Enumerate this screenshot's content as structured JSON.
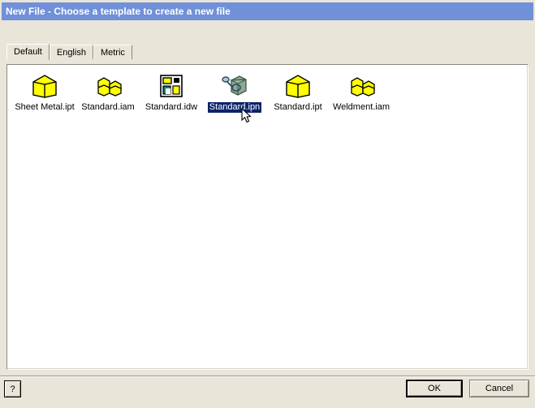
{
  "window": {
    "title": "New File - Choose a template to create a new file",
    "titlebar_color": "#7090d8",
    "background_color": "#e9e5d8"
  },
  "tabs": [
    {
      "label": "Default",
      "selected": true
    },
    {
      "label": "English",
      "selected": false
    },
    {
      "label": "Metric",
      "selected": false
    }
  ],
  "templates": [
    {
      "label": "Sheet Metal.ipt",
      "icon": "part-cube-icon",
      "selected": false
    },
    {
      "label": "Standard.iam",
      "icon": "assembly-cubes-icon",
      "selected": false
    },
    {
      "label": "Standard.idw",
      "icon": "drawing-sheet-icon",
      "selected": false
    },
    {
      "label": "Standard.ipn",
      "icon": "presentation-exploded-icon",
      "selected": true
    },
    {
      "label": "Standard.ipt",
      "icon": "part-cube-icon",
      "selected": false
    },
    {
      "label": "Weldment.iam",
      "icon": "assembly-cubes-icon",
      "selected": false
    }
  ],
  "selection": {
    "highlight_color": "#0a246a",
    "highlight_text_color": "#ffffff",
    "selected_label": "Standard.ipn"
  },
  "buttons": {
    "help_label": "?",
    "ok_label": "OK",
    "cancel_label": "Cancel"
  },
  "icon_colors": {
    "part_yellow": "#ffff00",
    "part_outline": "#000000",
    "drawing_teal": "#1a7f6e",
    "presentation_body": "#8fa890",
    "presentation_shade": "#6d8a72"
  }
}
